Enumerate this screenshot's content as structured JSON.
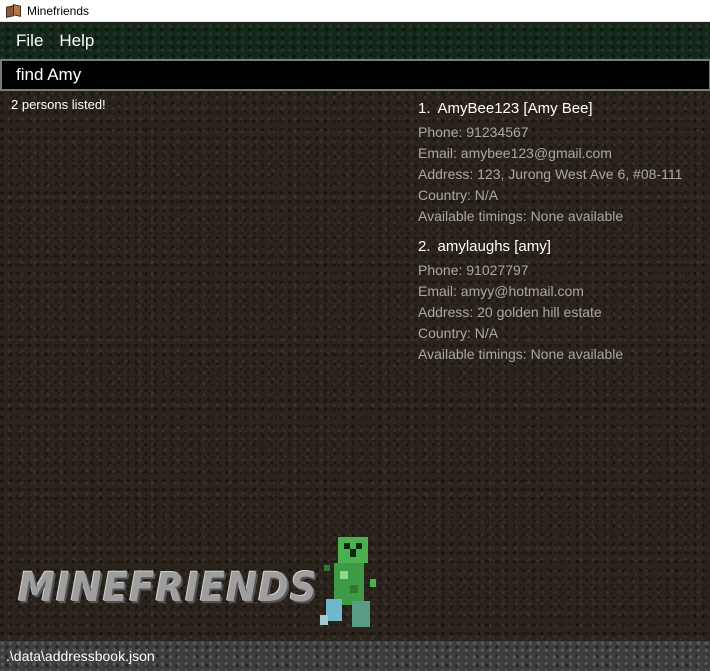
{
  "window": {
    "title": "Minefriends",
    "icon": "book-icon"
  },
  "menu": {
    "items": [
      "File",
      "Help"
    ]
  },
  "command": {
    "value": "find Amy"
  },
  "result": {
    "message": "2 persons listed!"
  },
  "persons": [
    {
      "index": "1.",
      "name": "AmyBee123 [Amy Bee]",
      "phone": "Phone: 91234567",
      "email": "Email: amybee123@gmail.com",
      "address": "Address: 123, Jurong West Ave 6, #08-111",
      "country": "Country: N/A",
      "timings": "Available timings: None available"
    },
    {
      "index": "2.",
      "name": "amylaughs [amy]",
      "phone": "Phone: 91027797",
      "email": "Email: amyy@hotmail.com",
      "address": "Address: 20 golden hill estate",
      "country": "Country: N/A",
      "timings": "Available timings: None available"
    }
  ],
  "logo": {
    "text": "MINEFRIENDS",
    "mascot": "creeper-icon"
  },
  "status": {
    "save_path": ".\\data\\addressbook.json"
  }
}
